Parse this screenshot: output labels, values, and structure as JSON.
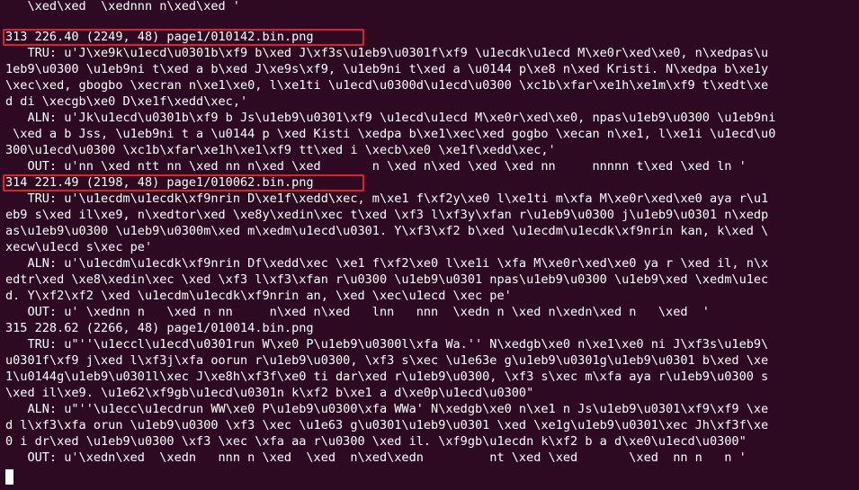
{
  "terminal": {
    "lines": [
      "   \\xed\\xed  \\xednnn n\\xed\\xed '",
      "313 226.40 (2249, 48) page1/010142.bin.png",
      "   TRU: u'J\\xe9k\\u1ecd\\u0301b\\xf9 b\\xed J\\xf3s\\u1eb9\\u0301f\\xf9 \\u1ecdk\\u1ecd M\\xe0r\\xed\\xe0, n\\xedpas\\u",
      "1eb9\\u0300 \\u1eb9ni t\\xed a b\\xed J\\xe9s\\xf9, \\u1eb9ni t\\xed a \\u0144 p\\xe8 n\\xed Kristi. N\\xedpa b\\xe1y",
      "\\xec\\xed, gbogbo \\xecran n\\xe1\\xe0, l\\xe1ti \\u1ecd\\u0300d\\u1ecd\\u0300 \\xc1b\\xfar\\xe1h\\xe1m\\xf9 t\\xedt\\xe",
      "d di \\xecgb\\xe0 D\\xe1f\\xedd\\xec,'",
      "   ALN: u'Jk\\u1ecd\\u0301b\\xf9 b Js\\u1eb9\\u0301\\xf9 \\u1ecd\\u1ecd M\\xe0r\\xed\\xe0, npas\\u1eb9\\u0300 \\u1eb9ni",
      " \\xed a b Jss, \\u1eb9ni t a \\u0144 p \\xed Kisti \\xedpa b\\xe1\\xec\\xed gogbo \\xecan n\\xe1, l\\xe1i \\u1ecd\\u0",
      "300\\u1ecd\\u0300 \\xc1b\\xfar\\xe1h\\xe1\\xf9 tt\\xed i \\xecb\\xe0 \\xe1f\\xedd\\xec,'",
      "   OUT: u'nn \\xed ntt nn \\xed nn n\\xed \\xed       n \\xed n\\xed \\xed \\xed nn     nnnnn t\\xed \\xed ln '",
      "314 221.49 (2198, 48) page1/010062.bin.png",
      "   TRU: u'\\u1ecdm\\u1ecdk\\xf9nrin D\\xe1f\\xedd\\xec, m\\xe1 f\\xf2y\\xe0 l\\xe1ti m\\xfa M\\xe0r\\xed\\xe0 aya r\\u1",
      "eb9 s\\xed il\\xe9, n\\xedtor\\xed \\xe8y\\xedin\\xec t\\xed \\xf3 l\\xf3y\\xfan r\\u1eb9\\u0300 j\\u1eb9\\u0301 n\\xedp",
      "as\\u1eb9\\u0300 \\u1eb9\\u0300m\\xed m\\xedm\\u1ecd\\u0301. Y\\xf3\\xf2 b\\xed \\u1ecdm\\u1ecdk\\xf9nrin kan, k\\xed \\",
      "xecw\\u1ecd s\\xec pe'",
      "   ALN: u'\\u1ecdm\\u1ecdk\\xf9nrin Df\\xedd\\xec \\xe1 f\\xf2\\xe0 l\\xe1i \\xfa M\\xe0r\\xed\\xe0 ya r \\xed il, n\\x",
      "edtr\\xed \\xe8\\xedin\\xec \\xed \\xf3 l\\xf3\\xfan r\\u0300 \\u1eb9\\u0301 npas\\u1eb9\\u0300 \\u1eb9\\xed \\xedm\\u1ec",
      "d. Y\\xf2\\xf2 \\xed \\u1ecdm\\u1ecdk\\xf9nrin an, \\xed \\xec\\u1ecd \\xec pe'",
      "   OUT: u' \\xednn n   \\xed n nn     n\\xed n\\xed   lnn   nnn  \\xedn n \\xed n\\xedn\\xed n   \\xed  '",
      "315 228.62 (2266, 48) page1/010014.bin.png",
      "   TRU: u\"''\\u1eccl\\u1ecd\\u0301run W\\xe0 P\\u1eb9\\u0300l\\xfa Wa.'' N\\xedgb\\xe0 n\\xe1\\xe0 ni J\\xf3s\\u1eb9\\",
      "u0301f\\xf9 j\\xed l\\xf3j\\xfa oorun r\\u1eb9\\u0300, \\xf3 s\\xec \\u1e63e g\\u1eb9\\u0301g\\u1eb9\\u0301 b\\xed \\xe",
      "1\\u0144g\\u1eb9\\u0301l\\xec J\\xe8h\\xf3f\\xe0 ti dar\\xed r\\u1eb9\\u0300, \\xf3 s\\xec m\\xfa aya r\\u1eb9\\u0300 s",
      "\\xed il\\xe9. \\u1e62\\xf9gb\\u1ecd\\u0301n k\\xf2 b\\xe1 a d\\xe0p\\u1ecd\\u0300\"",
      "   ALN: u\"''\\u1ecc\\u1ecdrun WW\\xe0 P\\u1eb9\\u0300\\xfa WWa' N\\xedgb\\xe0 n\\xe1 n Js\\u1eb9\\u0301\\xf9\\xf9 \\xe",
      "d l\\xf3\\xfa orun \\u1eb9\\u0300 \\xf3 \\xec \\u1e63 g\\u0301\\u1eb9\\u0301 \\xed \\xe1g\\u1eb9\\u0301\\xec Jh\\xf3f\\xe",
      "0 i dr\\xed \\u1eb9\\u0300 \\xf3 \\xec \\xfa aa r\\u0300 \\xed il. \\xf9gb\\u1ecdn k\\xf2 b a d\\xe0\\u1ecd\\u0300\"",
      "   OUT: u'\\xedn\\xed  \\xedn   nnn n \\xed  \\xed  n\\xed\\xedn         nt \\xed \\xed       \\xed  nn n   n '"
    ],
    "background_color": "#2d0a22",
    "text_color": "#ffffff",
    "highlight_color": "#e0202e"
  }
}
